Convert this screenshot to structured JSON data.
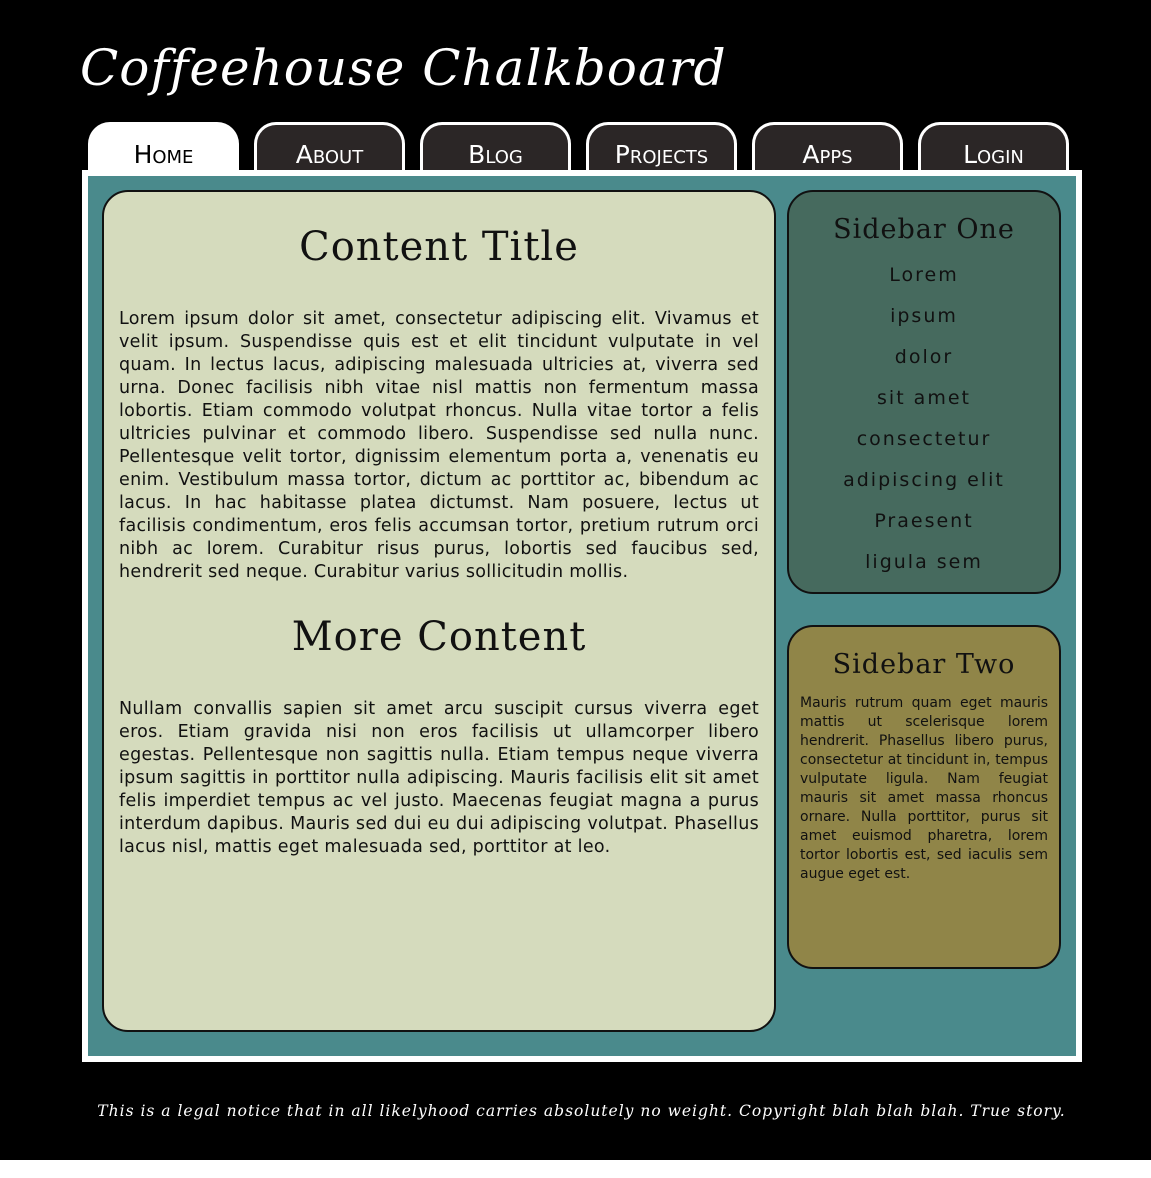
{
  "site": {
    "title": "Coffeehouse Chalkboard"
  },
  "nav": {
    "tabs": [
      {
        "label": "Home",
        "active": true
      },
      {
        "label": "About",
        "active": false
      },
      {
        "label": "Blog",
        "active": false
      },
      {
        "label": "Projects",
        "active": false
      },
      {
        "label": "Apps",
        "active": false
      },
      {
        "label": "Login",
        "active": false
      }
    ]
  },
  "main": {
    "title": "Content Title",
    "paragraph1": "Lorem ipsum dolor sit amet, consectetur adipiscing elit. Vivamus et velit ipsum. Suspendisse quis est et elit tincidunt vulputate in vel quam. In lectus lacus, adipiscing malesuada ultricies at, viverra sed urna. Donec facilisis nibh vitae nisl mattis non fermentum massa lobortis. Etiam commodo volutpat rhoncus. Nulla vitae tortor a felis ultricies pulvinar et commodo libero. Suspendisse sed nulla nunc. Pellentesque velit tortor, dignissim elementum porta a, venenatis eu enim. Vestibulum massa tortor, dictum ac porttitor ac, bibendum ac lacus. In hac habitasse platea dictumst. Nam posuere, lectus ut facilisis condimentum, eros felis accumsan tortor, pretium rutrum orci nibh ac lorem. Curabitur risus purus, lobortis sed faucibus sed, hendrerit sed neque. Curabitur varius sollicitudin mollis.",
    "subtitle": "More Content",
    "paragraph2": "Nullam convallis sapien sit amet arcu suscipit cursus viverra eget eros. Etiam gravida nisi non eros facilisis ut ullamcorper libero egestas. Pellentesque non sagittis nulla. Etiam tempus neque viverra ipsum sagittis in porttitor nulla adipiscing. Mauris facilisis elit sit amet felis imperdiet tempus ac vel justo. Maecenas feugiat magna a purus interdum dapibus. Mauris sed dui eu dui adipiscing volutpat. Phasellus lacus nisl, mattis eget malesuada sed, porttitor at leo."
  },
  "sidebar_one": {
    "title": "Sidebar One",
    "links": [
      "Lorem",
      "ipsum",
      "dolor",
      "sit amet",
      "consectetur",
      "adipiscing elit",
      "Praesent",
      "ligula sem"
    ]
  },
  "sidebar_two": {
    "title": "Sidebar Two",
    "text": "Mauris rutrum quam eget mauris mattis ut scelerisque lorem hendrerit. Phasellus libero purus, consectetur at tincidunt in, tempus vulputate ligula. Nam feugiat mauris sit amet massa rhoncus ornare. Nulla porttitor, purus sit amet euismod pharetra, lorem tortor lobortis est, sed iaculis sem augue eget est."
  },
  "footer": {
    "notice": "This is a legal notice that in all likelyhood carries absolutely no weight. Copyright blah blah blah. True story."
  },
  "colors": {
    "background": "#000000",
    "panel": "#4a8a8c",
    "content": "#d5dbbd",
    "sidebar_one": "#466a5e",
    "sidebar_two": "#908548"
  }
}
